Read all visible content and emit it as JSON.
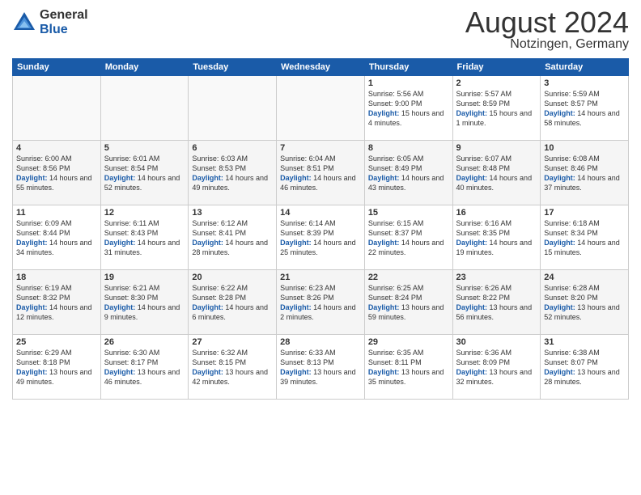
{
  "header": {
    "logo_general": "General",
    "logo_blue": "Blue",
    "month": "August 2024",
    "location": "Notzingen, Germany"
  },
  "weekdays": [
    "Sunday",
    "Monday",
    "Tuesday",
    "Wednesday",
    "Thursday",
    "Friday",
    "Saturday"
  ],
  "weeks": [
    [
      {
        "day": "",
        "sunrise": "",
        "sunset": "",
        "daylight": ""
      },
      {
        "day": "",
        "sunrise": "",
        "sunset": "",
        "daylight": ""
      },
      {
        "day": "",
        "sunrise": "",
        "sunset": "",
        "daylight": ""
      },
      {
        "day": "",
        "sunrise": "",
        "sunset": "",
        "daylight": ""
      },
      {
        "day": "1",
        "sunrise": "Sunrise: 5:56 AM",
        "sunset": "Sunset: 9:00 PM",
        "daylight": "Daylight: 15 hours and 4 minutes."
      },
      {
        "day": "2",
        "sunrise": "Sunrise: 5:57 AM",
        "sunset": "Sunset: 8:59 PM",
        "daylight": "Daylight: 15 hours and 1 minute."
      },
      {
        "day": "3",
        "sunrise": "Sunrise: 5:59 AM",
        "sunset": "Sunset: 8:57 PM",
        "daylight": "Daylight: 14 hours and 58 minutes."
      }
    ],
    [
      {
        "day": "4",
        "sunrise": "Sunrise: 6:00 AM",
        "sunset": "Sunset: 8:56 PM",
        "daylight": "Daylight: 14 hours and 55 minutes."
      },
      {
        "day": "5",
        "sunrise": "Sunrise: 6:01 AM",
        "sunset": "Sunset: 8:54 PM",
        "daylight": "Daylight: 14 hours and 52 minutes."
      },
      {
        "day": "6",
        "sunrise": "Sunrise: 6:03 AM",
        "sunset": "Sunset: 8:53 PM",
        "daylight": "Daylight: 14 hours and 49 minutes."
      },
      {
        "day": "7",
        "sunrise": "Sunrise: 6:04 AM",
        "sunset": "Sunset: 8:51 PM",
        "daylight": "Daylight: 14 hours and 46 minutes."
      },
      {
        "day": "8",
        "sunrise": "Sunrise: 6:05 AM",
        "sunset": "Sunset: 8:49 PM",
        "daylight": "Daylight: 14 hours and 43 minutes."
      },
      {
        "day": "9",
        "sunrise": "Sunrise: 6:07 AM",
        "sunset": "Sunset: 8:48 PM",
        "daylight": "Daylight: 14 hours and 40 minutes."
      },
      {
        "day": "10",
        "sunrise": "Sunrise: 6:08 AM",
        "sunset": "Sunset: 8:46 PM",
        "daylight": "Daylight: 14 hours and 37 minutes."
      }
    ],
    [
      {
        "day": "11",
        "sunrise": "Sunrise: 6:09 AM",
        "sunset": "Sunset: 8:44 PM",
        "daylight": "Daylight: 14 hours and 34 minutes."
      },
      {
        "day": "12",
        "sunrise": "Sunrise: 6:11 AM",
        "sunset": "Sunset: 8:43 PM",
        "daylight": "Daylight: 14 hours and 31 minutes."
      },
      {
        "day": "13",
        "sunrise": "Sunrise: 6:12 AM",
        "sunset": "Sunset: 8:41 PM",
        "daylight": "Daylight: 14 hours and 28 minutes."
      },
      {
        "day": "14",
        "sunrise": "Sunrise: 6:14 AM",
        "sunset": "Sunset: 8:39 PM",
        "daylight": "Daylight: 14 hours and 25 minutes."
      },
      {
        "day": "15",
        "sunrise": "Sunrise: 6:15 AM",
        "sunset": "Sunset: 8:37 PM",
        "daylight": "Daylight: 14 hours and 22 minutes."
      },
      {
        "day": "16",
        "sunrise": "Sunrise: 6:16 AM",
        "sunset": "Sunset: 8:35 PM",
        "daylight": "Daylight: 14 hours and 19 minutes."
      },
      {
        "day": "17",
        "sunrise": "Sunrise: 6:18 AM",
        "sunset": "Sunset: 8:34 PM",
        "daylight": "Daylight: 14 hours and 15 minutes."
      }
    ],
    [
      {
        "day": "18",
        "sunrise": "Sunrise: 6:19 AM",
        "sunset": "Sunset: 8:32 PM",
        "daylight": "Daylight: 14 hours and 12 minutes."
      },
      {
        "day": "19",
        "sunrise": "Sunrise: 6:21 AM",
        "sunset": "Sunset: 8:30 PM",
        "daylight": "Daylight: 14 hours and 9 minutes."
      },
      {
        "day": "20",
        "sunrise": "Sunrise: 6:22 AM",
        "sunset": "Sunset: 8:28 PM",
        "daylight": "Daylight: 14 hours and 6 minutes."
      },
      {
        "day": "21",
        "sunrise": "Sunrise: 6:23 AM",
        "sunset": "Sunset: 8:26 PM",
        "daylight": "Daylight: 14 hours and 2 minutes."
      },
      {
        "day": "22",
        "sunrise": "Sunrise: 6:25 AM",
        "sunset": "Sunset: 8:24 PM",
        "daylight": "Daylight: 13 hours and 59 minutes."
      },
      {
        "day": "23",
        "sunrise": "Sunrise: 6:26 AM",
        "sunset": "Sunset: 8:22 PM",
        "daylight": "Daylight: 13 hours and 56 minutes."
      },
      {
        "day": "24",
        "sunrise": "Sunrise: 6:28 AM",
        "sunset": "Sunset: 8:20 PM",
        "daylight": "Daylight: 13 hours and 52 minutes."
      }
    ],
    [
      {
        "day": "25",
        "sunrise": "Sunrise: 6:29 AM",
        "sunset": "Sunset: 8:18 PM",
        "daylight": "Daylight: 13 hours and 49 minutes."
      },
      {
        "day": "26",
        "sunrise": "Sunrise: 6:30 AM",
        "sunset": "Sunset: 8:17 PM",
        "daylight": "Daylight: 13 hours and 46 minutes."
      },
      {
        "day": "27",
        "sunrise": "Sunrise: 6:32 AM",
        "sunset": "Sunset: 8:15 PM",
        "daylight": "Daylight: 13 hours and 42 minutes."
      },
      {
        "day": "28",
        "sunrise": "Sunrise: 6:33 AM",
        "sunset": "Sunset: 8:13 PM",
        "daylight": "Daylight: 13 hours and 39 minutes."
      },
      {
        "day": "29",
        "sunrise": "Sunrise: 6:35 AM",
        "sunset": "Sunset: 8:11 PM",
        "daylight": "Daylight: 13 hours and 35 minutes."
      },
      {
        "day": "30",
        "sunrise": "Sunrise: 6:36 AM",
        "sunset": "Sunset: 8:09 PM",
        "daylight": "Daylight: 13 hours and 32 minutes."
      },
      {
        "day": "31",
        "sunrise": "Sunrise: 6:38 AM",
        "sunset": "Sunset: 8:07 PM",
        "daylight": "Daylight: 13 hours and 28 minutes."
      }
    ]
  ]
}
